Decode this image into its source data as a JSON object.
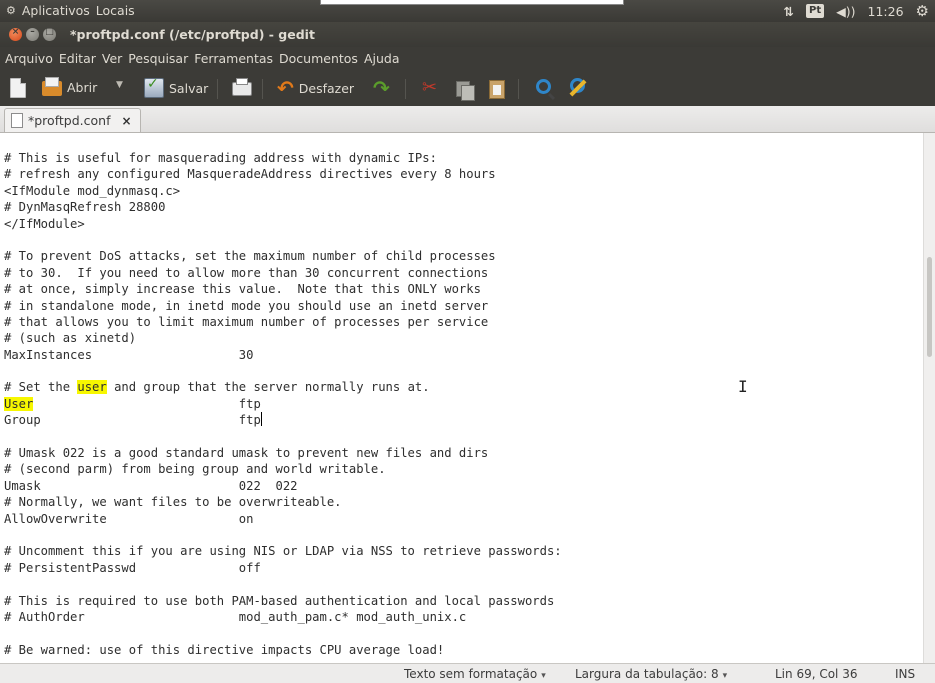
{
  "top_panel": {
    "apps_label": "Aplicativos",
    "places_label": "Locais",
    "keyboard_layout": "Pt",
    "clock": "11:26"
  },
  "window": {
    "title": "*proftpd.conf (/etc/proftpd) - gedit"
  },
  "menu": [
    "Arquivo",
    "Editar",
    "Ver",
    "Pesquisar",
    "Ferramentas",
    "Documentos",
    "Ajuda"
  ],
  "toolbar": {
    "open_label": "Abrir",
    "save_label": "Salvar",
    "undo_label": "Desfazer"
  },
  "tab": {
    "label": "*proftpd.conf",
    "close": "×"
  },
  "editor": {
    "lines": [
      "# This is useful for masquerading address with dynamic IPs:",
      "# refresh any configured MasqueradeAddress directives every 8 hours",
      "<IfModule mod_dynmasq.c>",
      "# DynMasqRefresh 28800",
      "</IfModule>",
      "",
      "# To prevent DoS attacks, set the maximum number of child processes",
      "# to 30.  If you need to allow more than 30 concurrent connections",
      "# at once, simply increase this value.  Note that this ONLY works",
      "# in standalone mode, in inetd mode you should use an inetd server",
      "# that allows you to limit maximum number of processes per service",
      "# (such as xinetd)",
      "MaxInstances                    30",
      "",
      "# Set the user and group that the server normally runs at.",
      "User                            ftp",
      "Group                           ftp",
      "",
      "# Umask 022 is a good standard umask to prevent new files and dirs",
      "# (second parm) from being group and world writable.",
      "Umask                           022  022",
      "# Normally, we want files to be overwriteable.",
      "AllowOverwrite                  on",
      "",
      "# Uncomment this if you are using NIS or LDAP via NSS to retrieve passwords:",
      "# PersistentPasswd              off",
      "",
      "# This is required to use both PAM-based authentication and local passwords",
      "# AuthOrder                     mod_auth_pam.c* mod_auth_unix.c",
      "",
      "# Be warned: use of this directive impacts CPU average load!"
    ],
    "highlight_term": "user",
    "highlight_term_capitalized": "User",
    "cursor_line": 16
  },
  "status": {
    "syntax": "Texto sem formatação",
    "tab_width": "Largura da tabulação: 8",
    "position": "Lin 69, Col 36",
    "mode": "INS"
  },
  "colors": {
    "highlight": "#f7f700",
    "panel": "#3c3b37",
    "close_button": "#e2561f"
  }
}
